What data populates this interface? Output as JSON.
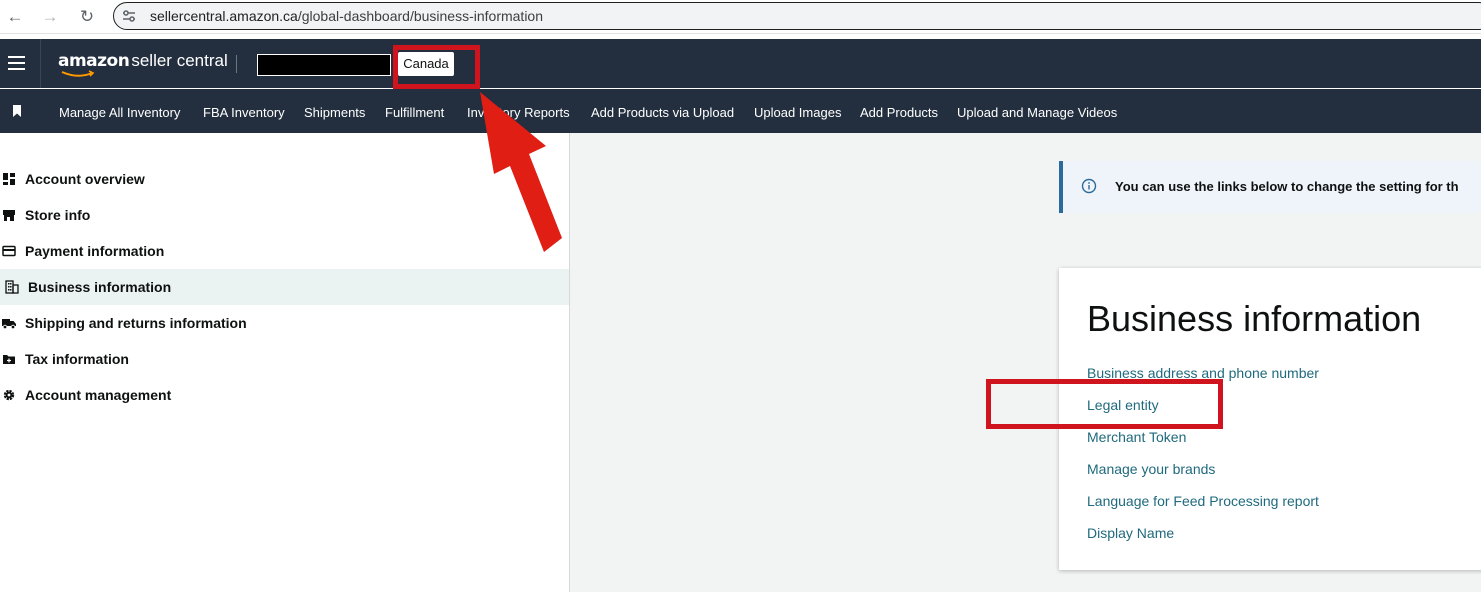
{
  "browser": {
    "url_host": "sellercentral.amazon.ca",
    "url_path": "/global-dashboard/business-information"
  },
  "header": {
    "logo_amazon": "amazon",
    "logo_suffix": "seller central",
    "marketplace": "Canada"
  },
  "quick_nav": {
    "items": [
      "Manage All Inventory",
      "FBA Inventory",
      "Shipments",
      "Fulfillment",
      "Inventory Reports",
      "Add Products via Upload",
      "Upload Images",
      "Add Products",
      "Upload and Manage Videos"
    ]
  },
  "sidebar": {
    "items": [
      {
        "label": "Account overview",
        "icon": "dashboard-icon"
      },
      {
        "label": "Store info",
        "icon": "store-icon"
      },
      {
        "label": "Payment information",
        "icon": "credit-card-icon"
      },
      {
        "label": "Business information",
        "icon": "building-icon",
        "active": true
      },
      {
        "label": "Shipping and returns information",
        "icon": "truck-icon"
      },
      {
        "label": "Tax information",
        "icon": "tax-folder-icon"
      },
      {
        "label": "Account management",
        "icon": "gear-icon"
      }
    ]
  },
  "main": {
    "alert_text": "You can use the links below to change the setting for th",
    "card_title": "Business information",
    "links": [
      "Business address and phone number",
      "Legal entity",
      "Merchant Token",
      "Manage your brands",
      "Language for Feed Processing report",
      "Display Name"
    ]
  },
  "colors": {
    "header_bg": "#232f3e",
    "link": "#1f6a7e",
    "annotation_red": "#d0141e",
    "active_bg": "#eaf2f2"
  }
}
